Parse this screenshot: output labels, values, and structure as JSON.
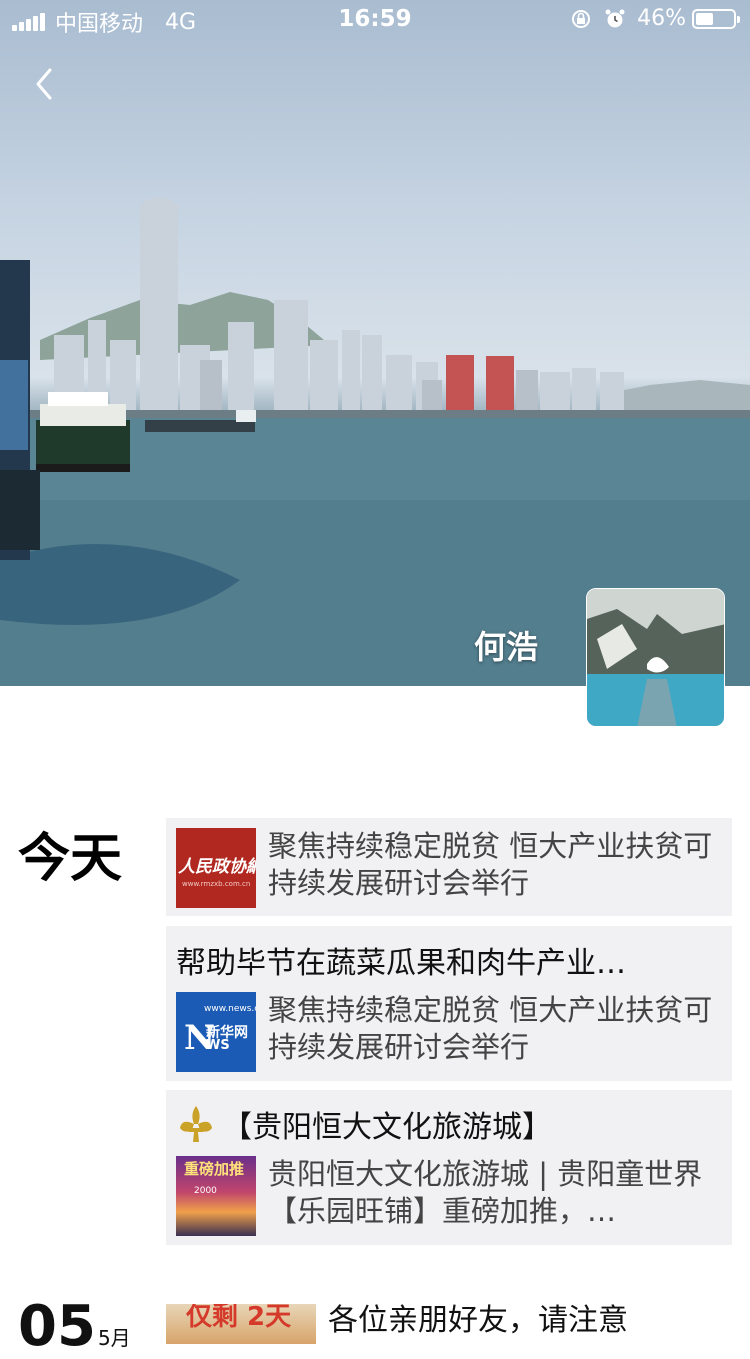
{
  "status_bar": {
    "carrier": "中国移动",
    "network": "4G",
    "time": "16:59",
    "battery_percent": "46%",
    "battery_level": 0.46
  },
  "header": {
    "back_icon": "chevron-left-icon",
    "user_name": "何浩"
  },
  "feed": {
    "groups": [
      {
        "date": "今天",
        "posts": [
          {
            "caption": "",
            "share_title": "聚焦持续稳定脱贫 恒大产业扶贫可持续发展研讨会举行",
            "thumb_logo": "人民政协網",
            "thumb_url": "www.rmzxb.com.cn"
          },
          {
            "caption": "帮助毕节在蔬菜瓜果和肉牛产业…",
            "share_title": "聚焦持续稳定脱贫 恒大产业扶贫可持续发展研讨会举行",
            "thumb_top": "www.news.cn",
            "thumb_n": "N",
            "thumb_cn": "新华网",
            "thumb_ws": "WS"
          },
          {
            "caption": "【贵阳恒大文化旅游城】",
            "caption_icon": "fleur-de-lis-icon",
            "share_title": "贵阳恒大文化旅游城 | 贵阳童世界【乐园旺铺】重磅加推，…",
            "thumb_t1": "重磅加推",
            "thumb_t2": "2000"
          }
        ]
      },
      {
        "day": "05",
        "month": "5月",
        "preview_text": "各位亲朋好友，请注意",
        "preview_thumb_text": "仅剩 2天"
      }
    ]
  },
  "colors": {
    "card_bg": "#f1f1f3",
    "rmzx_red": "#b0281f",
    "xinhua_blue": "#1c5bb5"
  }
}
